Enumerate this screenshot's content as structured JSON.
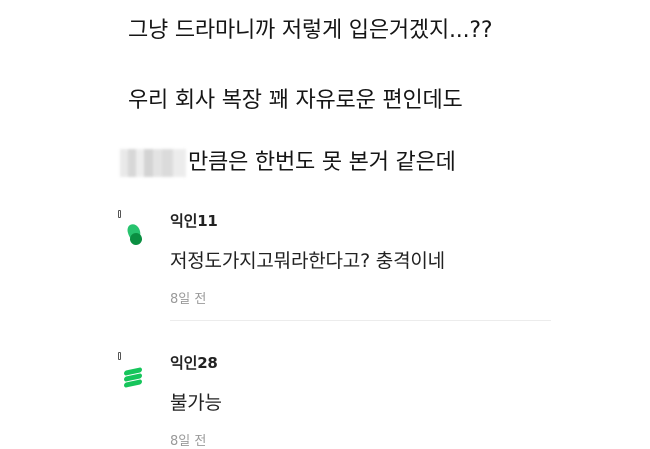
{
  "post": {
    "line1": "그냥 드라마니까 저렇게 입은거겠지...??",
    "line2": "우리 회사 복장 꽤 자유로운 편인데도",
    "line3_suffix": "만큼은 한번도 못 본거 같은데"
  },
  "comments": [
    {
      "author": "익인11",
      "text": "저정도가지고뭐라한다고? 충격이네",
      "time": "8일 전",
      "avatar_icon": "green-leaf-icon"
    },
    {
      "author": "익인28",
      "text": "불가능",
      "time": "8일 전",
      "avatar_icon": "green-stack-icon"
    }
  ],
  "colors": {
    "text": "#151515",
    "meta": "#9a9a9a",
    "divider": "#ececec",
    "avatar_green": "#27c36e",
    "avatar_dark_green": "#0a8f41"
  }
}
